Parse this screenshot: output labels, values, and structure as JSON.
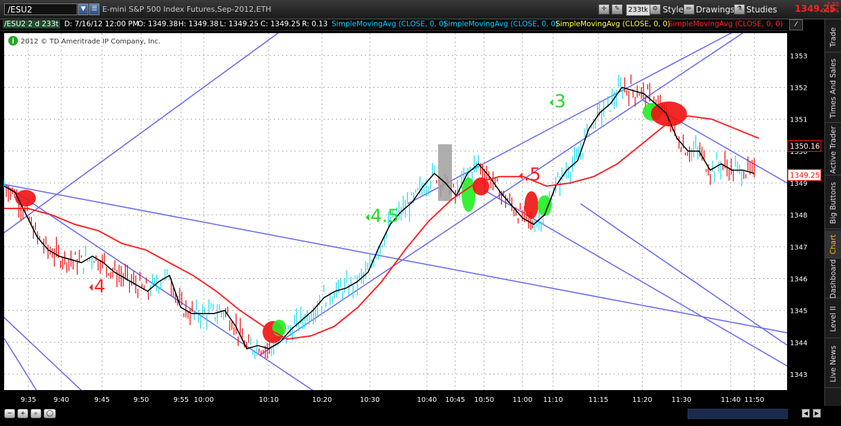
{
  "header": {
    "symbol": "/ESU2",
    "description": "E-mini S&P 500 Index Futures,Sep-2012,ETH",
    "tick_label": "233tk",
    "style_label": "Style",
    "drawings_label": "Drawings",
    "studies_label": "Studies",
    "last_price": "1349.25",
    "change_abs": "-2.50",
    "change_pct": "-0.18%"
  },
  "infobar": {
    "symbol_period": "/ESU2 2 d 233t",
    "date": "D: 7/16/12 12:00 PM",
    "open": "O: 1349.38",
    "high": "H: 1349.38",
    "low": "L: 1349.25",
    "close": "C: 1349.25",
    "range": "R: 0.13",
    "studies": [
      {
        "label": "SimpleMovingAvg (CLOSE, 0, 0)",
        "color": "#00ccff"
      },
      {
        "label": "SimpleMovingAvg (CLOSE, 0, 0)",
        "color": "#00ccff"
      },
      {
        "label": "SimpleMovingAvg (CLOSE, 0, 0)",
        "color": "#ffff44"
      },
      {
        "label": "SimpleMovingAvg (CLOSE, 0, 0)",
        "color": "#ff2020"
      }
    ]
  },
  "copyright": "2012 © TD Ameritrade IP Company, Inc.",
  "sidebar": {
    "tabs": [
      "Trade",
      "Times And Sales",
      "Active Trader",
      "Big Buttons",
      "Chart",
      "Dashboard",
      "Level II",
      "Live News"
    ],
    "active": "Chart"
  },
  "chart_data": {
    "type": "line",
    "title": "",
    "xlabel": "",
    "ylabel": "",
    "ylim": [
      1342.5,
      1353.7
    ],
    "yticks": [
      1343,
      1344,
      1345,
      1346,
      1347,
      1348,
      1349,
      1350,
      1351,
      1352,
      1353
    ],
    "xticks": [
      "9:35",
      "9:40",
      "9:45",
      "9:50",
      "9:55",
      "10:00",
      "10:10",
      "10:20",
      "10:30",
      "10:40",
      "10:45",
      "10:50",
      "11:00",
      "11:10",
      "11:15",
      "11:20",
      "11:30",
      "11:40",
      "11:50"
    ],
    "grid": true,
    "series": [
      {
        "color": "#000000",
        "values": [
          1348.9,
          1348.7,
          1348.0,
          1347.3,
          1346.9,
          1346.7,
          1346.6,
          1346.5,
          1346.7,
          1346.5,
          1346.2,
          1346.0,
          1345.8,
          1345.6,
          1345.9,
          1346.1,
          1345.1,
          1344.9,
          1344.9,
          1344.9,
          1345.0,
          1344.5,
          1343.8,
          1343.9,
          1343.8,
          1344.0,
          1344.4,
          1344.7,
          1345.0,
          1345.4,
          1345.6,
          1345.7,
          1345.9,
          1346.2,
          1347.0,
          1347.7,
          1348.1,
          1348.4,
          1348.9,
          1349.3,
          1349.0,
          1348.6,
          1349.3,
          1349.6,
          1349.2,
          1348.7,
          1348.3,
          1347.9,
          1347.7,
          1348.0,
          1348.9,
          1349.4,
          1349.7,
          1350.7,
          1351.2,
          1351.5,
          1352.0,
          1351.9,
          1351.8,
          1351.5,
          1351.2,
          1350.4,
          1350.0,
          1350.0,
          1349.4,
          1349.6,
          1349.4,
          1349.4,
          1349.3
        ]
      },
      {
        "color": "#ff2020",
        "values": [
          1348.2,
          1348.2,
          1348.0,
          1347.7,
          1347.5,
          1347.1,
          1346.9,
          1346.5,
          1346.1,
          1345.6,
          1345.0,
          1344.5,
          1344.1,
          1344.2,
          1344.5,
          1345.1,
          1345.9,
          1346.9,
          1347.8,
          1348.5,
          1349.0,
          1349.2,
          1349.2,
          1348.9,
          1349.0,
          1349.2,
          1349.6,
          1350.2,
          1350.8,
          1351.1,
          1351.0,
          1350.7,
          1350.4
        ]
      }
    ],
    "annotations": [
      {
        "text": "4",
        "color": "#ff2020",
        "x": "9:45",
        "y": 1345.7
      },
      {
        "text": "4.5",
        "color": "#22dd22",
        "x": "10:20",
        "y": 1347.9
      },
      {
        "text": ".5",
        "color": "#ff2020",
        "x": "10:50",
        "y": 1349.2
      },
      {
        "text": "3",
        "color": "#22dd22",
        "x": "11:10",
        "y": 1351.5
      }
    ],
    "price_labels": [
      {
        "text": "1350.16",
        "value": 1350.16
      },
      {
        "text": "1349.25",
        "value": 1349.25
      }
    ]
  }
}
